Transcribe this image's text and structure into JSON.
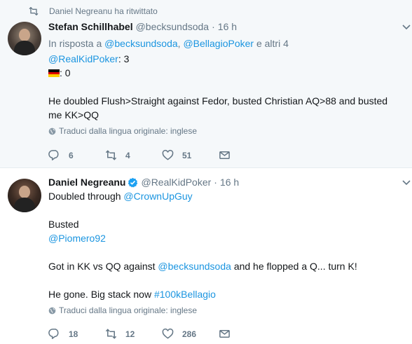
{
  "tweet1": {
    "retweet_context": "Daniel Negreanu ha ritwittato",
    "name": "Stefan Schillhabel",
    "handle": "@becksundsoda",
    "dot": "·",
    "time": "16 h",
    "reply_prefix": "In risposta a",
    "reply_user1": "@becksundsoda",
    "reply_sep": ",",
    "reply_user2": "@BellagioPoker",
    "reply_suffix": "e altri 4",
    "score_user": "@RealKidPoker",
    "score_user_value": ": 3",
    "score_flag_value": ": 0",
    "body": "He doubled Flush>Straight against Fedor, busted Christian AQ>88 and busted me KK>QQ",
    "translate": "Traduci dalla lingua originale: inglese",
    "replies": "6",
    "retweets": "4",
    "likes": "51"
  },
  "tweet2": {
    "name": "Daniel Negreanu",
    "handle": "@RealKidPoker",
    "dot": "·",
    "time": "16 h",
    "line1_prefix": "Doubled through",
    "line1_user": "@CrownUpGuy",
    "line2": "Busted",
    "line3_user": "@Piomero92",
    "line4_prefix": "Got in KK vs QQ against",
    "line4_user": "@becksundsoda",
    "line4_suffix": "and he flopped a Q... turn K!",
    "line5_prefix": "He gone. Big stack now",
    "line5_hashtag": "#100kBellagio",
    "translate": "Traduci dalla lingua originale: inglese",
    "replies": "18",
    "retweets": "12",
    "likes": "286"
  },
  "icons": {
    "retweet_context": "retweet-icon",
    "reply": "reply-icon",
    "retweet": "retweet-icon",
    "like": "heart-icon",
    "dm": "envelope-icon",
    "verified": "verified-badge-icon",
    "caret": "chevron-down-icon",
    "globe": "globe-icon",
    "flag": "germany-flag-icon"
  },
  "colors": {
    "link": "#1b95e0",
    "secondary_text": "#657786",
    "primary_text": "#14171a",
    "highlight_bg": "#f5f8fa"
  }
}
